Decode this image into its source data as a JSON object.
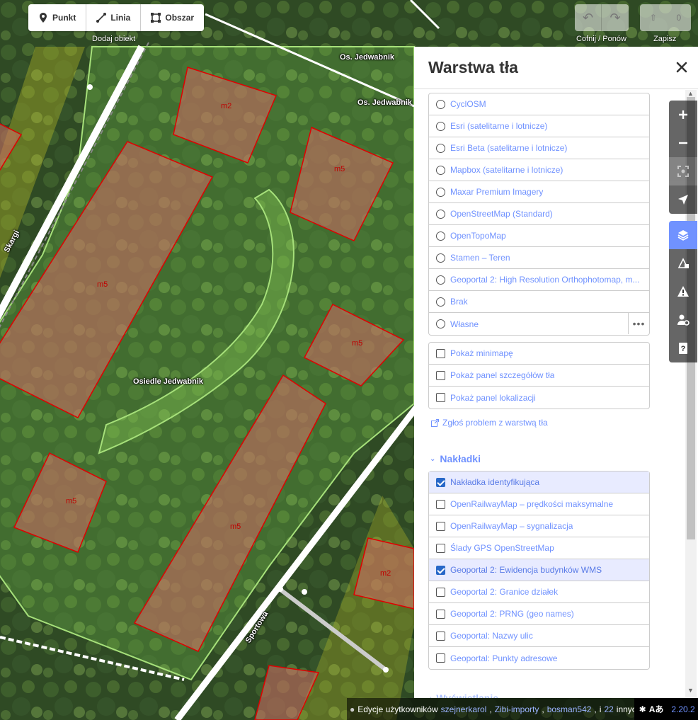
{
  "toolbar": {
    "add_point": "Punkt",
    "add_line": "Linia",
    "add_area": "Obszar",
    "add_caption": "Dodaj obiekt",
    "undo_caption": "Cofnij / Ponów",
    "save_caption": "Zapisz",
    "save_count": "0"
  },
  "map": {
    "labels": {
      "stop1": "Os. Jedwabnik",
      "stop2": "Os. Jedwabnik",
      "estate": "Osiedle Jedwabnik",
      "street1": "Sportowa",
      "street2": "Skargi"
    },
    "building_code_m2": "m2",
    "building_code_m5": "m5"
  },
  "panel": {
    "title": "Warstwa tła",
    "background_layers": [
      {
        "label": "CyclOSM"
      },
      {
        "label": "Esri (satelitarne i lotnicze)"
      },
      {
        "label": "Esri Beta (satelitarne i lotnicze)"
      },
      {
        "label": "Mapbox (satelitarne i lotnicze)"
      },
      {
        "label": "Maxar Premium Imagery"
      },
      {
        "label": "OpenStreetMap (Standard)"
      },
      {
        "label": "OpenTopoMap"
      },
      {
        "label": "Stamen – Teren"
      },
      {
        "label": "Geoportal 2: High Resolution Orthophotomap, m..."
      },
      {
        "label": "Brak"
      },
      {
        "label": "Własne"
      }
    ],
    "display_options": [
      {
        "label": "Pokaż minimapę"
      },
      {
        "label": "Pokaż panel szczegółów tła"
      },
      {
        "label": "Pokaż panel lokalizacji"
      }
    ],
    "report_link": "Zgłoś problem z warstwą tła",
    "overlays_heading": "Nakładki",
    "overlays": [
      {
        "label": "Nakładka identyfikująca",
        "checked": true
      },
      {
        "label": "OpenRailwayMap – prędkości maksymalne",
        "checked": false
      },
      {
        "label": "OpenRailwayMap – sygnalizacja",
        "checked": false
      },
      {
        "label": "Ślady GPS OpenStreetMap",
        "checked": false
      },
      {
        "label": "Geoportal 2: Ewidencja budynków WMS",
        "checked": true
      },
      {
        "label": "Geoportal 2: Granice działek",
        "checked": false
      },
      {
        "label": "Geoportal 2: PRNG (geo names)",
        "checked": false
      },
      {
        "label": "Geoportal: Nazwy ulic",
        "checked": false
      },
      {
        "label": "Geoportal: Punkty adresowe",
        "checked": false
      }
    ],
    "next_heading": "Wyświetlanie"
  },
  "footer": {
    "edits_prefix": "Edycje użytkowników",
    "users": [
      "szejnerkarol",
      "Zibi-importy",
      "bosman542"
    ],
    "sep": ",",
    "and": "i",
    "others_count": "22",
    "others_suffix": "innych",
    "version": "2.20.2"
  },
  "colors": {
    "accent": "#7092ff",
    "overlay_highlight": "#e8ebff",
    "building_outline": "#e00000"
  }
}
